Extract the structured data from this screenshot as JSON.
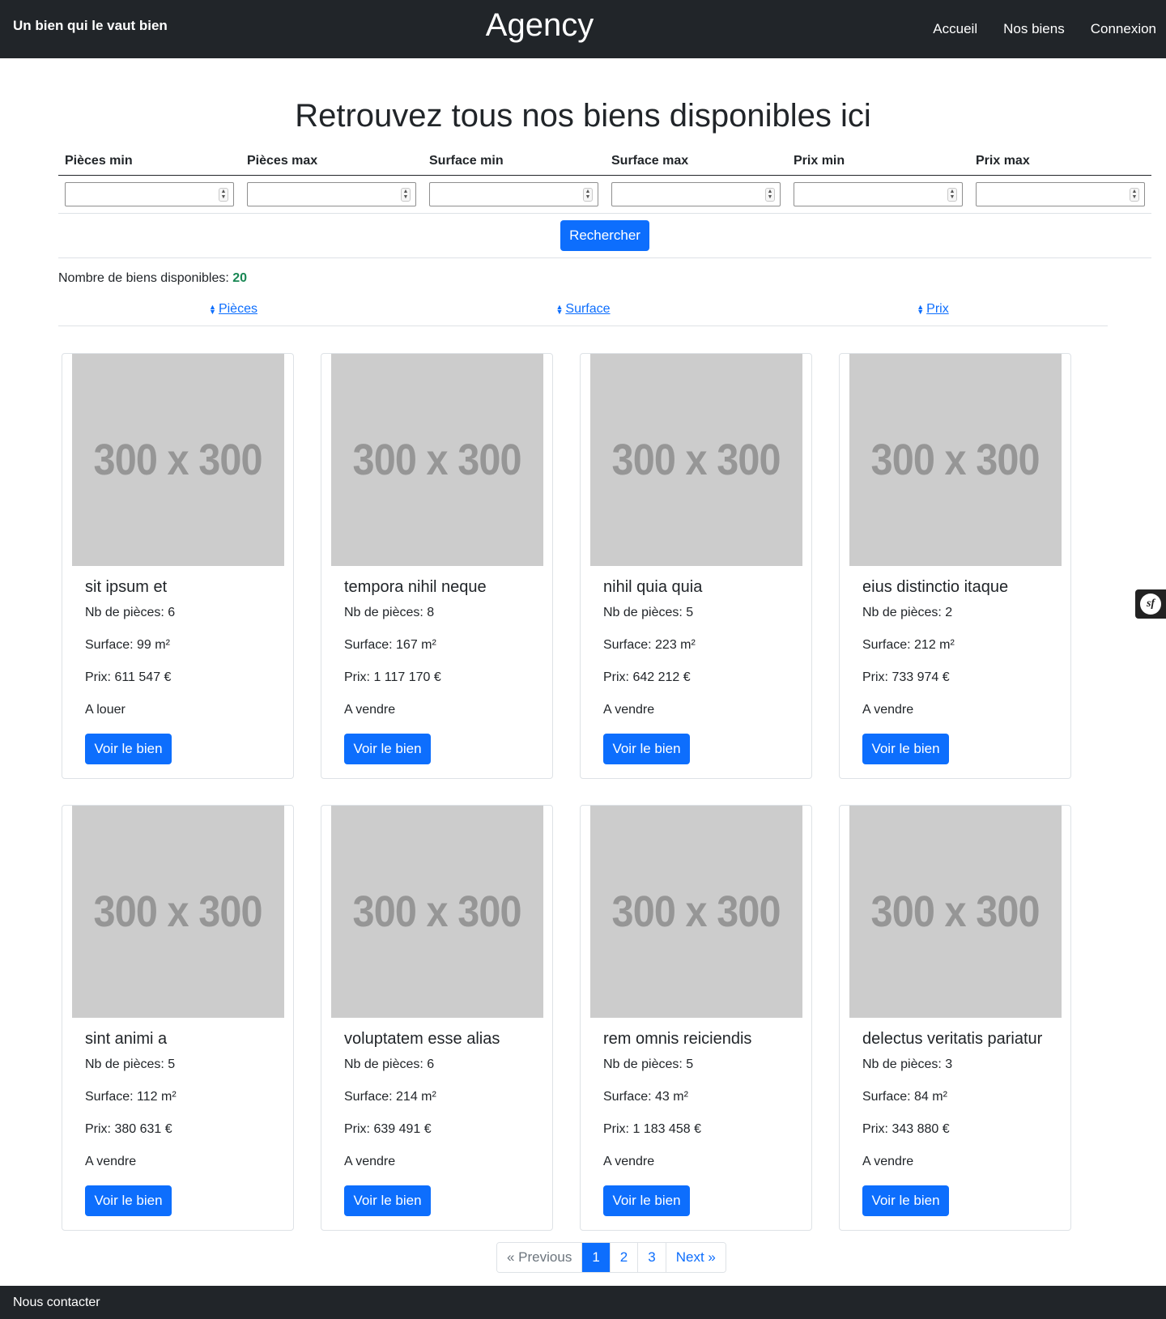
{
  "header": {
    "tagline": "Un bien qui le vaut bien",
    "title": "Agency",
    "nav": [
      {
        "label": "Accueil"
      },
      {
        "label": "Nos biens"
      },
      {
        "label": "Connexion"
      }
    ]
  },
  "page": {
    "heading": "Retrouvez tous nos biens disponibles ici"
  },
  "filters": {
    "labels": [
      "Pièces min",
      "Pièces max",
      "Surface min",
      "Surface max",
      "Prix min",
      "Prix max"
    ],
    "values": [
      "",
      "",
      "",
      "",
      "",
      ""
    ],
    "search_label": "Rechercher"
  },
  "results": {
    "count_label": "Nombre de biens disponibles:",
    "count": "20"
  },
  "sort": {
    "items": [
      {
        "label": "Pièces"
      },
      {
        "label": "Surface"
      },
      {
        "label": "Prix"
      }
    ]
  },
  "cards": [
    {
      "image_text": "300 x 300",
      "title": "sit ipsum et",
      "rooms": "Nb de pièces: 6",
      "surface": "Surface: 99 m²",
      "price": "Prix: 611 547 €",
      "type": "A louer",
      "button": "Voir le bien"
    },
    {
      "image_text": "300 x 300",
      "title": "tempora nihil neque",
      "rooms": "Nb de pièces: 8",
      "surface": "Surface: 167 m²",
      "price": "Prix: 1 117 170 €",
      "type": "A vendre",
      "button": "Voir le bien"
    },
    {
      "image_text": "300 x 300",
      "title": "nihil quia quia",
      "rooms": "Nb de pièces: 5",
      "surface": "Surface: 223 m²",
      "price": "Prix: 642 212 €",
      "type": "A vendre",
      "button": "Voir le bien"
    },
    {
      "image_text": "300 x 300",
      "title": "eius distinctio itaque",
      "rooms": "Nb de pièces: 2",
      "surface": "Surface: 212 m²",
      "price": "Prix: 733 974 €",
      "type": "A vendre",
      "button": "Voir le bien"
    },
    {
      "image_text": "300 x 300",
      "title": "sint animi a",
      "rooms": "Nb de pièces: 5",
      "surface": "Surface: 112 m²",
      "price": "Prix: 380 631 €",
      "type": "A vendre",
      "button": "Voir le bien"
    },
    {
      "image_text": "300 x 300",
      "title": "voluptatem esse alias",
      "rooms": "Nb de pièces: 6",
      "surface": "Surface: 214 m²",
      "price": "Prix: 639 491 €",
      "type": "A vendre",
      "button": "Voir le bien"
    },
    {
      "image_text": "300 x 300",
      "title": "rem omnis reiciendis",
      "rooms": "Nb de pièces: 5",
      "surface": "Surface: 43 m²",
      "price": "Prix: 1 183 458 €",
      "type": "A vendre",
      "button": "Voir le bien"
    },
    {
      "image_text": "300 x 300",
      "title": "delectus veritatis pariatur",
      "rooms": "Nb de pièces: 3",
      "surface": "Surface: 84 m²",
      "price": "Prix: 343 880 €",
      "type": "A vendre",
      "button": "Voir le bien"
    }
  ],
  "pagination": {
    "previous": "« Previous",
    "pages": [
      "1",
      "2",
      "3"
    ],
    "active": "1",
    "next": "Next »"
  },
  "footer": {
    "contact": "Nous contacter"
  },
  "debug_toolbar": {
    "icon": "symfony-icon",
    "label": "sf"
  },
  "colors": {
    "navbar": "#212529",
    "primary": "#0d6efd",
    "success": "#198754",
    "placeholder_bg": "#cccccc",
    "placeholder_text": "#969696"
  }
}
